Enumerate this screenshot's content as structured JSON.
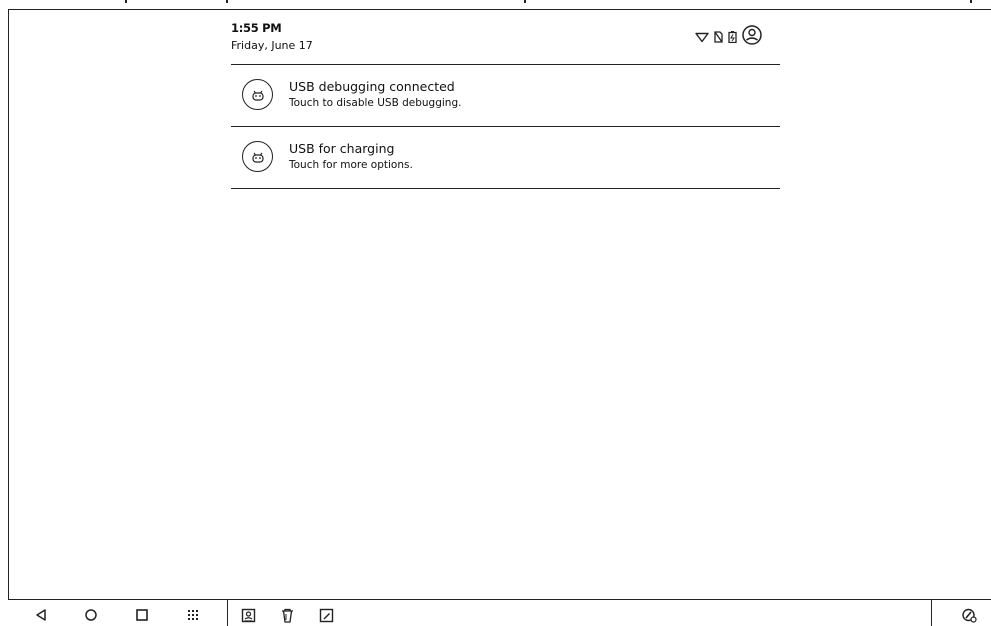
{
  "status_bar": {
    "time": "1:55 PM",
    "date": "Friday, June 17",
    "icons": [
      "wifi-icon",
      "no-sim-icon",
      "battery-icon",
      "account-icon"
    ]
  },
  "notifications": [
    {
      "icon": "android-icon",
      "title": "USB debugging connected",
      "text": "Touch to disable USB debugging."
    },
    {
      "icon": "android-icon",
      "title": "USB for charging",
      "text": "Touch for more options."
    }
  ],
  "taskbar": {
    "nav": [
      "back-icon",
      "home-icon",
      "recents-icon",
      "apps-grid-icon"
    ],
    "shortcuts": [
      "contacts-icon",
      "trash-icon",
      "edit-icon"
    ],
    "right": [
      "pen-settings-icon"
    ]
  }
}
